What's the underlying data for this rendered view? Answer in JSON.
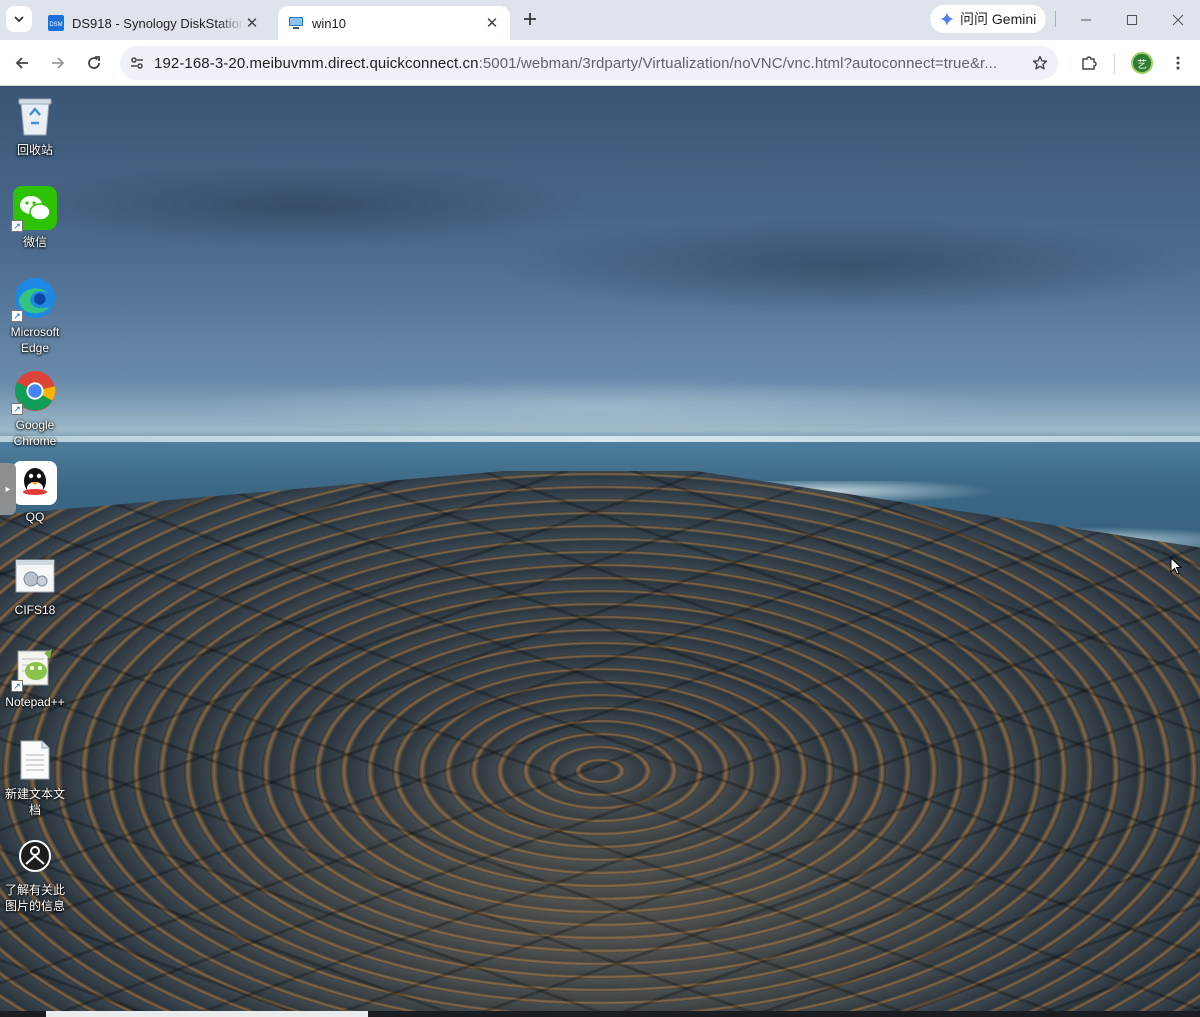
{
  "tabs": [
    {
      "title": "DS918 - Synology DiskStation",
      "favicon": "dsm-icon",
      "active": false,
      "favicon_text": "DSM"
    },
    {
      "title": "win10",
      "favicon": "vm-icon",
      "active": true
    }
  ],
  "gemini_label": "问问 Gemini",
  "address": {
    "host": "192-168-3-20.meibuvmm.direct.quickconnect.cn",
    "rest": ":5001/webman/3rdparty/Virtualization/noVNC/vnc.html?autoconnect=true&r..."
  },
  "profile_initial": "艺",
  "desktop_icons": [
    {
      "label": "回收站",
      "icon": "recycle-bin-icon"
    },
    {
      "label": "微信",
      "icon": "wechat-icon"
    },
    {
      "label": "Microsoft Edge",
      "icon": "edge-icon"
    },
    {
      "label": "Google Chrome",
      "icon": "chrome-icon"
    },
    {
      "label": "QQ",
      "icon": "qq-icon"
    },
    {
      "label": "CIFS18",
      "icon": "cifs-icon"
    },
    {
      "label": "Notepad++",
      "icon": "notepad-plus-plus-icon"
    },
    {
      "label": "新建文本文档",
      "icon": "text-document-icon"
    },
    {
      "label": "了解有关此图片的信息",
      "icon": "spotlight-info-icon"
    }
  ],
  "colors": {
    "tabstrip": "#dfe3eb",
    "omnibox": "#eef1f7",
    "wechat": "#2dc100",
    "edge": "#1e88e5"
  }
}
